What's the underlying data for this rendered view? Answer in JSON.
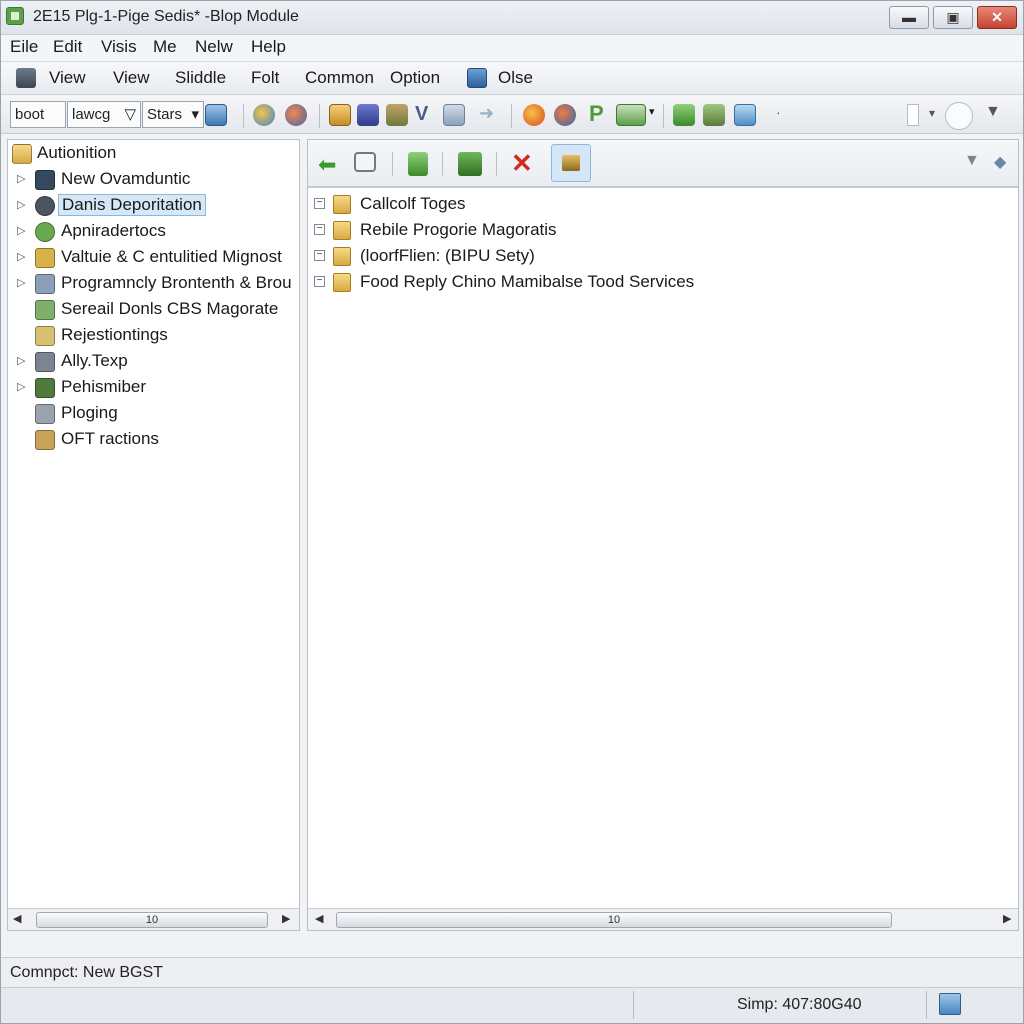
{
  "window": {
    "title": "2E15 Plg-1-Pige Sedis* -Blop Module",
    "minimize": "▬",
    "maximize": "▣",
    "close": "✕"
  },
  "menu": [
    "Eile",
    "Edit",
    "Visis",
    "Me",
    "Nelw",
    "Help"
  ],
  "toolbar1": {
    "items": [
      "View",
      "View",
      "Sliddle",
      "Folt",
      "Common",
      "Option",
      "Olse"
    ]
  },
  "toolbar2": {
    "combo1": "boot",
    "combo2": "lawcg",
    "combo2_arrow": "▽",
    "combo3": "Stars",
    "combo3_arrow": "▾",
    "p_label": "P",
    "v_label": "V"
  },
  "tree": {
    "root": "Autionition",
    "items": [
      {
        "label": "New Ovamduntic",
        "expander": "▷",
        "icon_color": "#34495e"
      },
      {
        "label": "Danis Deporitation",
        "expander": "▷",
        "icon_color": "#4a5560",
        "selected": true
      },
      {
        "label": "Apniradertocs",
        "expander": "▷",
        "icon_color": "#6aa84f"
      },
      {
        "label": "Valtuie & C entulitied Mignost",
        "expander": "▷",
        "icon_color": "#d7b24a"
      },
      {
        "label": "Programncly Brontenth & Brou",
        "expander": "▷",
        "icon_color": "#8aa0b8"
      },
      {
        "label": "Sereail Donls CBS Magorate",
        "expander": "",
        "icon_color": "#7fb06a"
      },
      {
        "label": "Rejestiontings",
        "expander": "",
        "icon_color": "#d8c070"
      },
      {
        "label": "Ally.Texp",
        "expander": "▷",
        "icon_color": "#7a8591"
      },
      {
        "label": "Pehismiber",
        "expander": "▷",
        "icon_color": "#4f7a3c"
      },
      {
        "label": "Ploging",
        "expander": "",
        "icon_color": "#9aa3ad"
      },
      {
        "label": "OFT ractions",
        "expander": "",
        "icon_color": "#c9a25a"
      }
    ]
  },
  "left_scroll": {
    "thumb": "10",
    "left_arrow": "◀",
    "right_arrow": "▶"
  },
  "right_scroll": {
    "thumb": "10",
    "left_arrow": "◀",
    "right_arrow": "▶"
  },
  "list": {
    "items": [
      {
        "label": "Callcolf Toges",
        "expander": "⊟"
      },
      {
        "label": "Rebile Progorie Magoratis",
        "expander": "⊟"
      },
      {
        "label": "(loorfFlien: (BIPU Sety)",
        "expander": "⊟"
      },
      {
        "label": "Food Reply Chino Mamibalse Tood Services",
        "expander": "⊟"
      }
    ]
  },
  "status": {
    "left": "Comnpct: New BGST",
    "right": "Simp: 407:80G40"
  }
}
